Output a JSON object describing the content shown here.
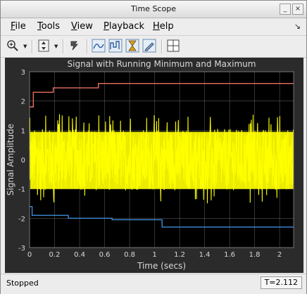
{
  "window": {
    "title": "Time Scope"
  },
  "menu": {
    "items": [
      {
        "label": "File",
        "key": "F",
        "rest": "ile"
      },
      {
        "label": "Tools",
        "key": "T",
        "rest": "ools"
      },
      {
        "label": "View",
        "key": "V",
        "rest": "iew"
      },
      {
        "label": "Playback",
        "key": "P",
        "rest": "layback"
      },
      {
        "label": "Help",
        "key": "H",
        "rest": "elp"
      }
    ]
  },
  "toolbar": {
    "icons": [
      "zoom-icon",
      "scale-axes-icon",
      "keep-in-front-icon",
      "cursor-measurements-icon",
      "signal-statistics-icon",
      "peak-finder-icon",
      "bilevel-measurements-icon",
      "layout-icon"
    ]
  },
  "colors": {
    "plot_bg": "#000000",
    "axes_bg": "#2b2b2b",
    "signal": "#ffff00",
    "running_max": "#e8715e",
    "running_min": "#3d8bd8",
    "text": "#d8d8d8",
    "grid": "#555555"
  },
  "chart_data": {
    "type": "line",
    "title": "Signal with Running Minimum and Maximum",
    "xlabel": "Time (secs)",
    "ylabel": "Signal Amplitude",
    "xlim": [
      0,
      2.112
    ],
    "ylim": [
      -3,
      3
    ],
    "xticks": [
      "0",
      "0.2",
      "0.4",
      "0.6",
      "0.8",
      "1",
      "1.2",
      "1.4",
      "1.6",
      "1.8",
      "2"
    ],
    "yticks": [
      "-3",
      "-2",
      "-1",
      "0",
      "1",
      "2",
      "3"
    ],
    "grid": true,
    "series": [
      {
        "color": "#e8715e",
        "x": [
          0,
          0.03,
          0.03,
          0.19,
          0.19,
          0.55,
          0.55,
          2.112
        ],
        "y": [
          1.8,
          1.8,
          2.3,
          2.3,
          2.45,
          2.45,
          2.6,
          2.6
        ]
      },
      {
        "color": "#3d8bd8",
        "x": [
          0,
          0.02,
          0.02,
          0.31,
          0.31,
          0.66,
          0.66,
          1.06,
          1.06,
          2.112
        ],
        "y": [
          -1.6,
          -1.6,
          -1.9,
          -1.9,
          -2.0,
          -2.0,
          -2.05,
          -2.05,
          -2.3,
          -2.3
        ]
      },
      {
        "color": "#ffff00",
        "x": [
          0,
          2.112
        ],
        "y_envelope": [
          -1.4,
          1.35
        ],
        "description": "noisy signal between approx -1.4 and 1.4 with spikes"
      }
    ]
  },
  "status": {
    "state": "Stopped",
    "time": "T=2.112"
  }
}
